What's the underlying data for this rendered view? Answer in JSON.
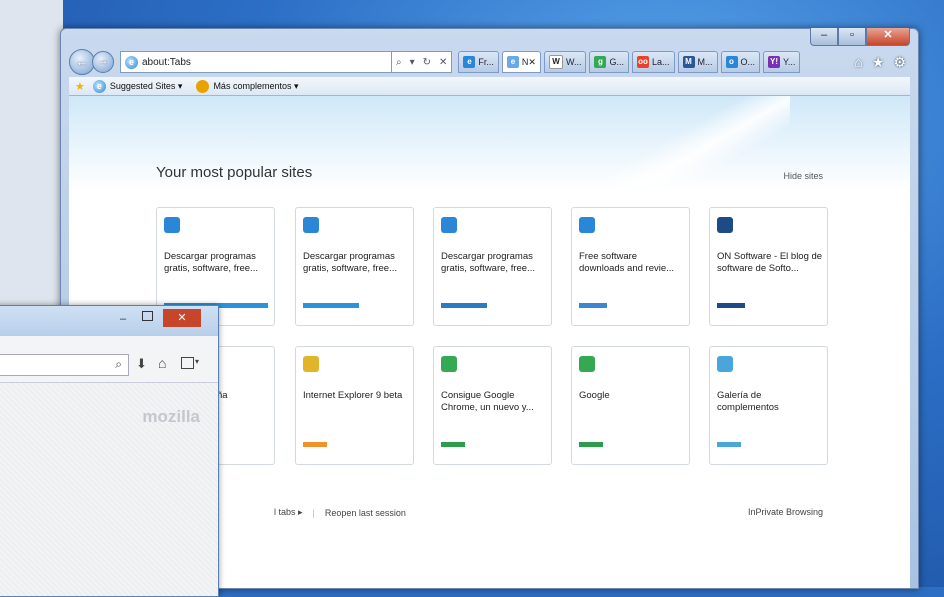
{
  "address_bar": {
    "url": "about:Tabs"
  },
  "tabs": [
    {
      "label": "Fr...",
      "color": "#2a86d6",
      "glyph": "e"
    },
    {
      "label": "N",
      "color": "#6aa8e8",
      "glyph": "e",
      "active": true
    },
    {
      "label": "W...",
      "color": "#ffffff",
      "glyph": "W"
    },
    {
      "label": "G...",
      "color": "#34a853",
      "glyph": "g"
    },
    {
      "label": "La...",
      "color": "#e8422e",
      "glyph": "oo"
    },
    {
      "label": "M...",
      "color": "#2b5797",
      "glyph": "M"
    },
    {
      "label": "O...",
      "color": "#2a86d6",
      "glyph": "o"
    },
    {
      "label": "Y...",
      "color": "#7b2fb5",
      "glyph": "Y!"
    }
  ],
  "favorites_bar": {
    "suggested": "Suggested Sites ▾",
    "more": "Más complementos ▾"
  },
  "content": {
    "heading": "Your most popular sites",
    "hide_sites": "Hide sites",
    "reopen_tabs": "l tabs ▸",
    "reopen_session": "Reopen last session",
    "inprivate": "InPrivate Browsing"
  },
  "tiles": [
    {
      "text": "Descargar programas gratis, software, free...",
      "bar": 104,
      "color": "#2a93d9",
      "icon": "#2a86d6"
    },
    {
      "text": "Descargar programas gratis, software, free...",
      "bar": 56,
      "color": "#2a93d9",
      "icon": "#2a86d6"
    },
    {
      "text": "Descargar programas gratis, software, free...",
      "bar": 46,
      "color": "#2a7cc2",
      "icon": "#2a86d6"
    },
    {
      "text": "Free software downloads and revie...",
      "bar": 28,
      "color": "#3b86cf",
      "icon": "#2a86d6"
    },
    {
      "text": "ON Software - El blog de software de Softo...",
      "bar": 28,
      "color": "#1c4b86",
      "icon": "#1c4b86"
    },
    {
      "text": "ña",
      "bar": 0,
      "color": "#cccccc",
      "icon": "#cccccc"
    },
    {
      "text": "Internet Explorer 9 beta",
      "bar": 24,
      "color": "#f0922b",
      "icon": "#e0b52a"
    },
    {
      "text": "Consigue Google Chrome, un nuevo y...",
      "bar": 24,
      "color": "#2d9c4b",
      "icon": "#34a853"
    },
    {
      "text": "Google",
      "bar": 24,
      "color": "#2d9c4b",
      "icon": "#34a853"
    },
    {
      "text": "Galería de complementos",
      "bar": 24,
      "color": "#4aa5da",
      "icon": "#4aa5da"
    }
  ],
  "firefox": {
    "logo": "mozilla",
    "close": "✕"
  }
}
